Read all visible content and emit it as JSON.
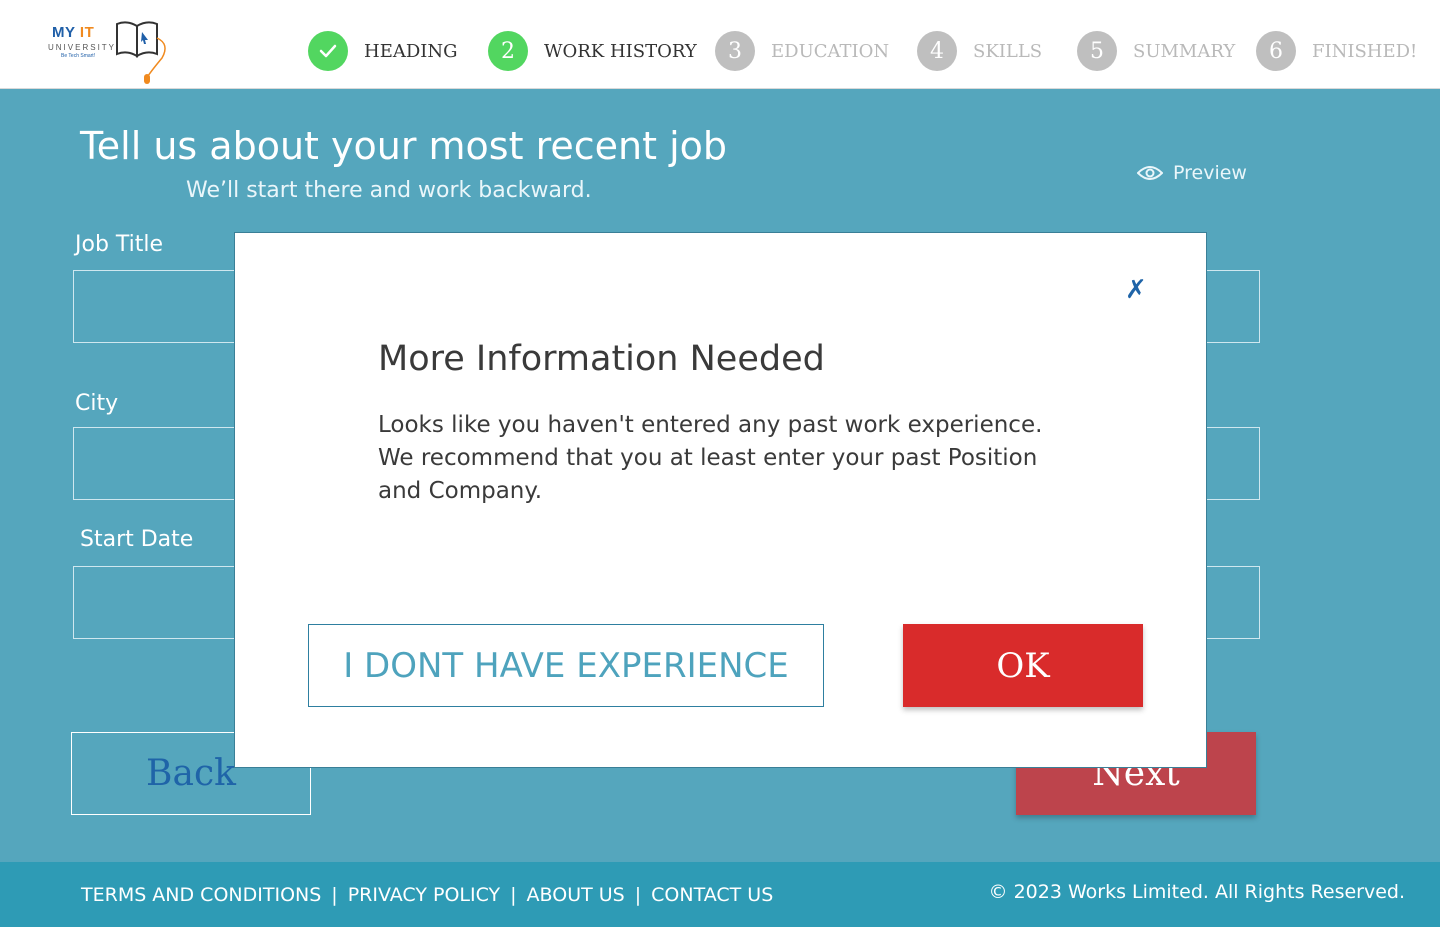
{
  "logo": {
    "brand_my": "MY",
    "brand_it": "IT",
    "university": "UNIVERSITY",
    "tagline": "Be Tech Smart!"
  },
  "steps": [
    {
      "number": "",
      "label": "HEADING",
      "state": "done",
      "icon": "check-icon"
    },
    {
      "number": "2",
      "label": "WORK HISTORY",
      "state": "active"
    },
    {
      "number": "3",
      "label": "EDUCATION",
      "state": "pending"
    },
    {
      "number": "4",
      "label": "SKILLS",
      "state": "pending"
    },
    {
      "number": "5",
      "label": "SUMMARY",
      "state": "pending"
    },
    {
      "number": "6",
      "label": "FINISHED!",
      "state": "pending"
    }
  ],
  "main": {
    "title": "Tell us about your most recent job",
    "subtitle": "We’ll start there and work backward.",
    "preview_label": "Preview",
    "fields": {
      "job_title": {
        "label": "Job Title",
        "value": ""
      },
      "city": {
        "label": "City",
        "value": ""
      },
      "start_date": {
        "label": "Start Date",
        "value": ""
      }
    },
    "back_label": "Back",
    "next_label": "Next"
  },
  "modal": {
    "close_glyph": "✗",
    "title": "More Information Needed",
    "body": "Looks like you haven't entered any past work experience. We recommend that you at least enter your past Position and Company.",
    "no_experience_label": "I DONT HAVE EXPERIENCE",
    "ok_label": "OK"
  },
  "footer": {
    "links": [
      "TERMS AND CONDITIONS",
      "PRIVACY POLICY",
      "ABOUT US",
      "CONTACT US"
    ],
    "separator": "|",
    "copyright": "© 2023 Works Limited. All Rights Reserved."
  },
  "colors": {
    "page_background": "#55a6bd",
    "step_active": "#52d660",
    "step_pending": "#bfbfbf",
    "ok_button": "#d92b2b",
    "next_button": "#bd444c",
    "footer": "#2e9bb5"
  }
}
